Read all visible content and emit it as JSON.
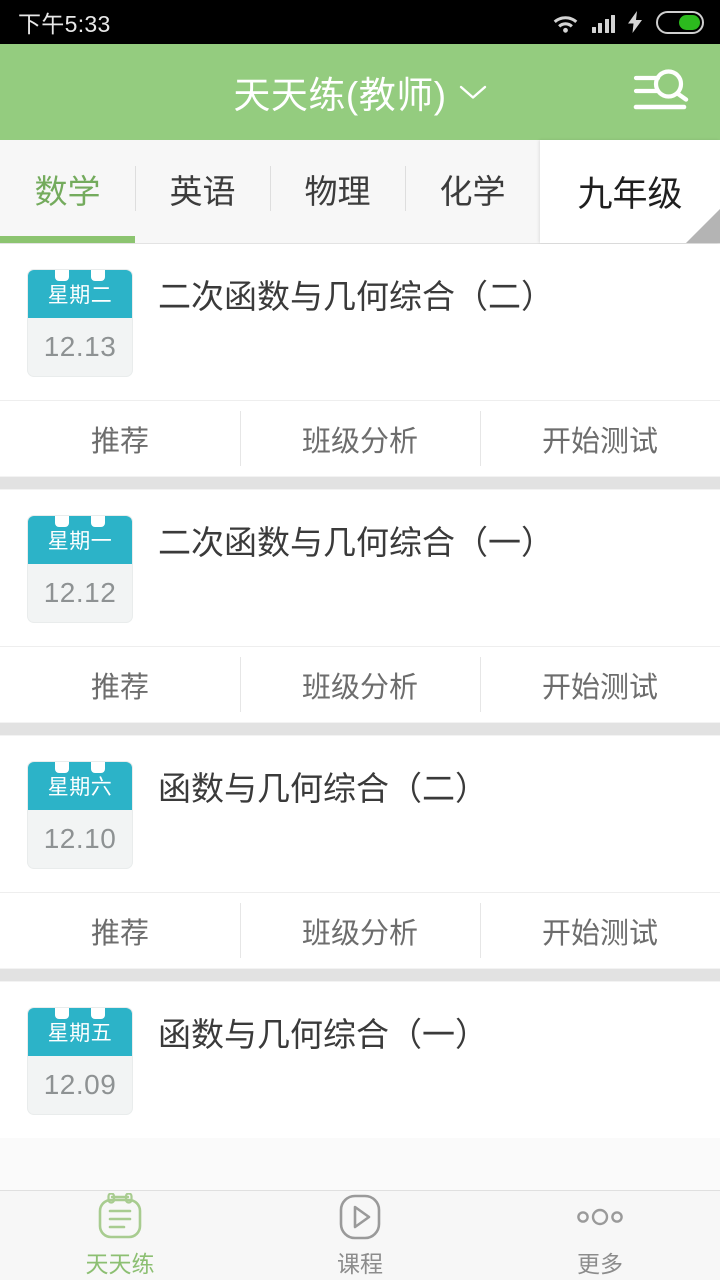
{
  "statusbar": {
    "time": "下午5:33",
    "icons": [
      "wifi-icon",
      "signal-icon",
      "charging-bolt-icon",
      "battery-icon"
    ],
    "battery_level_pct": 52
  },
  "header": {
    "title": "天天练(教师)",
    "dropdown_icon": "chevron-down-icon",
    "search_icon": "search-list-icon",
    "bg_color": "#94cc7f",
    "title_color": "#ffffff"
  },
  "tabs": {
    "items": [
      {
        "label": "数学",
        "active": true
      },
      {
        "label": "英语",
        "active": false
      },
      {
        "label": "物理",
        "active": false
      },
      {
        "label": "化学",
        "active": false
      }
    ],
    "active_color": "#74ab5d",
    "indicator_color": "#8cc470",
    "grade_selector": {
      "label": "九年级"
    }
  },
  "list": {
    "action_labels": [
      "推荐",
      "班级分析",
      "开始测试"
    ],
    "items": [
      {
        "weekday": "星期二",
        "date": "12.13",
        "title": "二次函数与几何综合（二）"
      },
      {
        "weekday": "星期一",
        "date": "12.12",
        "title": "二次函数与几何综合（一）"
      },
      {
        "weekday": "星期六",
        "date": "12.10",
        "title": "函数与几何综合（二）"
      },
      {
        "weekday": "星期五",
        "date": "12.09",
        "title": "函数与几何综合（一）"
      }
    ],
    "calendar_accent_color": "#2cb3c8"
  },
  "bottomnav": {
    "items": [
      {
        "label": "天天练",
        "icon": "notebook-icon",
        "active": true
      },
      {
        "label": "课程",
        "icon": "play-icon",
        "active": false
      },
      {
        "label": "更多",
        "icon": "more-dots-icon",
        "active": false
      }
    ],
    "active_color": "#8cbf72",
    "inactive_color": "#8c8c8c"
  }
}
